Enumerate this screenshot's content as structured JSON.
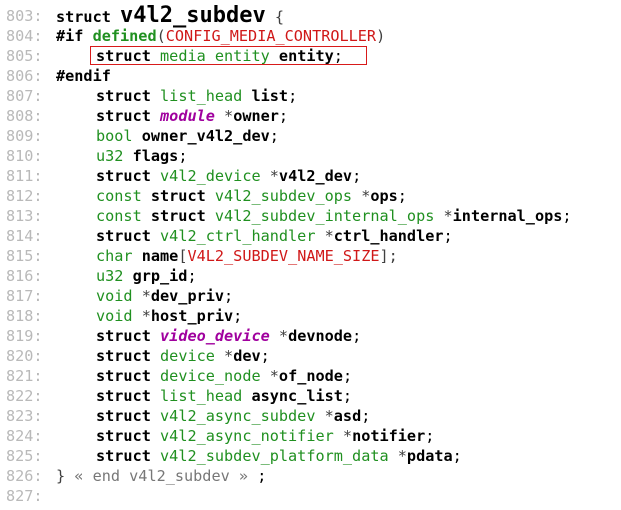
{
  "source_view": {
    "lines": [
      {
        "num": "803:",
        "indent": 0,
        "tokens": [
          {
            "t": "struct",
            "c": "kw"
          },
          {
            "t": " ",
            "c": "p"
          },
          {
            "t": "v4l2_subdev",
            "c": "big"
          },
          {
            "t": " {",
            "c": "op"
          }
        ]
      },
      {
        "num": "804:",
        "indent": 0,
        "tokens": [
          {
            "t": "#if",
            "c": "pp"
          },
          {
            "t": " ",
            "c": "p"
          },
          {
            "t": "defined",
            "c": "ppfn"
          },
          {
            "t": "(",
            "c": "op"
          },
          {
            "t": "CONFIG_MEDIA_CONTROLLER",
            "c": "mac"
          },
          {
            "t": ")",
            "c": "op"
          }
        ]
      },
      {
        "num": "805:",
        "indent": 1,
        "highlight": true,
        "tokens": [
          {
            "t": "struct",
            "c": "kw"
          },
          {
            "t": " ",
            "c": "p"
          },
          {
            "t": "media_entity",
            "c": "ty"
          },
          {
            "t": " ",
            "c": "p"
          },
          {
            "t": "entity",
            "c": "id"
          },
          {
            "t": ";",
            "c": "p"
          }
        ]
      },
      {
        "num": "806:",
        "indent": 0,
        "tokens": [
          {
            "t": "#endif",
            "c": "pp"
          }
        ]
      },
      {
        "num": "807:",
        "indent": 1,
        "tokens": [
          {
            "t": "struct",
            "c": "kw"
          },
          {
            "t": " ",
            "c": "p"
          },
          {
            "t": "list_head",
            "c": "ty"
          },
          {
            "t": " ",
            "c": "p"
          },
          {
            "t": "list",
            "c": "id"
          },
          {
            "t": ";",
            "c": "p"
          }
        ]
      },
      {
        "num": "808:",
        "indent": 1,
        "tokens": [
          {
            "t": "struct",
            "c": "kw"
          },
          {
            "t": " ",
            "c": "p"
          },
          {
            "t": "module",
            "c": "tyi"
          },
          {
            "t": " *",
            "c": "op"
          },
          {
            "t": "owner",
            "c": "id"
          },
          {
            "t": ";",
            "c": "p"
          }
        ]
      },
      {
        "num": "809:",
        "indent": 1,
        "tokens": [
          {
            "t": "bool",
            "c": "ty"
          },
          {
            "t": " ",
            "c": "p"
          },
          {
            "t": "owner_v4l2_dev",
            "c": "id"
          },
          {
            "t": ";",
            "c": "p"
          }
        ]
      },
      {
        "num": "810:",
        "indent": 1,
        "tokens": [
          {
            "t": "u32",
            "c": "ty"
          },
          {
            "t": " ",
            "c": "p"
          },
          {
            "t": "flags",
            "c": "id"
          },
          {
            "t": ";",
            "c": "p"
          }
        ]
      },
      {
        "num": "811:",
        "indent": 1,
        "tokens": [
          {
            "t": "struct",
            "c": "kw"
          },
          {
            "t": " ",
            "c": "p"
          },
          {
            "t": "v4l2_device",
            "c": "ty"
          },
          {
            "t": " *",
            "c": "op"
          },
          {
            "t": "v4l2_dev",
            "c": "id"
          },
          {
            "t": ";",
            "c": "p"
          }
        ]
      },
      {
        "num": "812:",
        "indent": 1,
        "tokens": [
          {
            "t": "const",
            "c": "ty"
          },
          {
            "t": " ",
            "c": "p"
          },
          {
            "t": "struct",
            "c": "kw"
          },
          {
            "t": " ",
            "c": "p"
          },
          {
            "t": "v4l2_subdev_ops",
            "c": "ty"
          },
          {
            "t": " *",
            "c": "op"
          },
          {
            "t": "ops",
            "c": "id"
          },
          {
            "t": ";",
            "c": "p"
          }
        ]
      },
      {
        "num": "813:",
        "indent": 1,
        "tokens": [
          {
            "t": "const",
            "c": "ty"
          },
          {
            "t": " ",
            "c": "p"
          },
          {
            "t": "struct",
            "c": "kw"
          },
          {
            "t": " ",
            "c": "p"
          },
          {
            "t": "v4l2_subdev_internal_ops",
            "c": "ty"
          },
          {
            "t": " *",
            "c": "op"
          },
          {
            "t": "internal_ops",
            "c": "id"
          },
          {
            "t": ";",
            "c": "p"
          }
        ]
      },
      {
        "num": "814:",
        "indent": 1,
        "tokens": [
          {
            "t": "struct",
            "c": "kw"
          },
          {
            "t": " ",
            "c": "p"
          },
          {
            "t": "v4l2_ctrl_handler",
            "c": "ty"
          },
          {
            "t": " *",
            "c": "op"
          },
          {
            "t": "ctrl_handler",
            "c": "id"
          },
          {
            "t": ";",
            "c": "p"
          }
        ]
      },
      {
        "num": "815:",
        "indent": 1,
        "tokens": [
          {
            "t": "char",
            "c": "ty"
          },
          {
            "t": " ",
            "c": "p"
          },
          {
            "t": "name",
            "c": "id"
          },
          {
            "t": "[",
            "c": "op"
          },
          {
            "t": "V4L2_SUBDEV_NAME_SIZE",
            "c": "mac"
          },
          {
            "t": "];",
            "c": "op"
          }
        ]
      },
      {
        "num": "816:",
        "indent": 1,
        "tokens": [
          {
            "t": "u32",
            "c": "ty"
          },
          {
            "t": " ",
            "c": "p"
          },
          {
            "t": "grp_id",
            "c": "id"
          },
          {
            "t": ";",
            "c": "p"
          }
        ]
      },
      {
        "num": "817:",
        "indent": 1,
        "tokens": [
          {
            "t": "void",
            "c": "ty"
          },
          {
            "t": " *",
            "c": "op"
          },
          {
            "t": "dev_priv",
            "c": "id"
          },
          {
            "t": ";",
            "c": "p"
          }
        ]
      },
      {
        "num": "818:",
        "indent": 1,
        "tokens": [
          {
            "t": "void",
            "c": "ty"
          },
          {
            "t": " *",
            "c": "op"
          },
          {
            "t": "host_priv",
            "c": "id"
          },
          {
            "t": ";",
            "c": "p"
          }
        ]
      },
      {
        "num": "819:",
        "indent": 1,
        "tokens": [
          {
            "t": "struct",
            "c": "kw"
          },
          {
            "t": " ",
            "c": "p"
          },
          {
            "t": "video_device",
            "c": "tyi"
          },
          {
            "t": " *",
            "c": "op"
          },
          {
            "t": "devnode",
            "c": "id"
          },
          {
            "t": ";",
            "c": "p"
          }
        ]
      },
      {
        "num": "820:",
        "indent": 1,
        "tokens": [
          {
            "t": "struct",
            "c": "kw"
          },
          {
            "t": " ",
            "c": "p"
          },
          {
            "t": "device",
            "c": "ty"
          },
          {
            "t": " *",
            "c": "op"
          },
          {
            "t": "dev",
            "c": "id"
          },
          {
            "t": ";",
            "c": "p"
          }
        ]
      },
      {
        "num": "821:",
        "indent": 1,
        "tokens": [
          {
            "t": "struct",
            "c": "kw"
          },
          {
            "t": " ",
            "c": "p"
          },
          {
            "t": "device_node",
            "c": "ty"
          },
          {
            "t": " *",
            "c": "op"
          },
          {
            "t": "of_node",
            "c": "id"
          },
          {
            "t": ";",
            "c": "p"
          }
        ]
      },
      {
        "num": "822:",
        "indent": 1,
        "tokens": [
          {
            "t": "struct",
            "c": "kw"
          },
          {
            "t": " ",
            "c": "p"
          },
          {
            "t": "list_head",
            "c": "ty"
          },
          {
            "t": " ",
            "c": "p"
          },
          {
            "t": "async_list",
            "c": "id"
          },
          {
            "t": ";",
            "c": "p"
          }
        ]
      },
      {
        "num": "823:",
        "indent": 1,
        "tokens": [
          {
            "t": "struct",
            "c": "kw"
          },
          {
            "t": " ",
            "c": "p"
          },
          {
            "t": "v4l2_async_subdev",
            "c": "ty"
          },
          {
            "t": " *",
            "c": "op"
          },
          {
            "t": "asd",
            "c": "id"
          },
          {
            "t": ";",
            "c": "p"
          }
        ]
      },
      {
        "num": "824:",
        "indent": 1,
        "tokens": [
          {
            "t": "struct",
            "c": "kw"
          },
          {
            "t": " ",
            "c": "p"
          },
          {
            "t": "v4l2_async_notifier",
            "c": "ty"
          },
          {
            "t": " *",
            "c": "op"
          },
          {
            "t": "notifier",
            "c": "id"
          },
          {
            "t": ";",
            "c": "p"
          }
        ]
      },
      {
        "num": "825:",
        "indent": 1,
        "tokens": [
          {
            "t": "struct",
            "c": "kw"
          },
          {
            "t": " ",
            "c": "p"
          },
          {
            "t": "v4l2_subdev_platform_data",
            "c": "ty"
          },
          {
            "t": " *",
            "c": "op"
          },
          {
            "t": "pdata",
            "c": "id"
          },
          {
            "t": ";",
            "c": "p"
          }
        ]
      },
      {
        "num": "826:",
        "indent": 0,
        "tokens": [
          {
            "t": "}",
            "c": "op"
          },
          {
            "t": " « end v4l2_subdev » ",
            "c": "grey"
          },
          {
            "t": ";",
            "c": "p"
          }
        ]
      },
      {
        "num": "827:",
        "indent": 0,
        "tokens": []
      }
    ]
  },
  "colors": {
    "line_number": "#b9b9b9",
    "type_green": "#209020",
    "macro_red": "#d01818",
    "italic_type_purple": "#a0009e",
    "highlight_border": "#d81a1a"
  }
}
